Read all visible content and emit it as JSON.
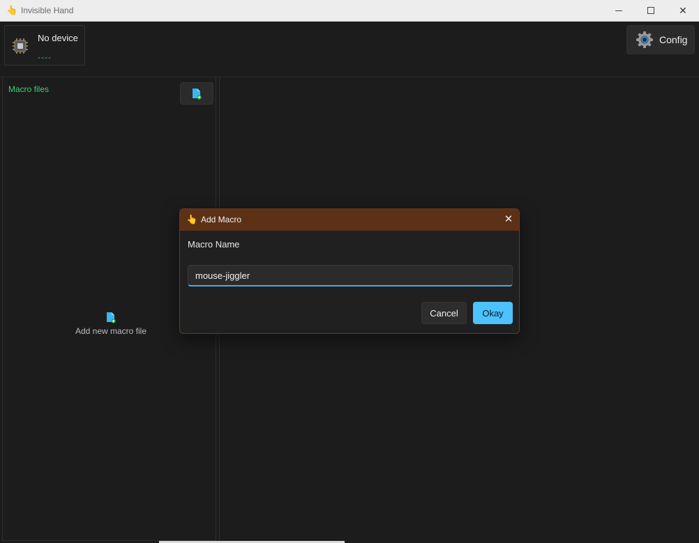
{
  "window": {
    "title": "Invisible Hand",
    "icon": "hand-icon"
  },
  "header": {
    "device": {
      "name": "No device",
      "status": "----",
      "icon": "chip-icon"
    },
    "config": {
      "label": "Config",
      "icon": "gear-icon"
    }
  },
  "sidebar": {
    "title": "Macro files",
    "empty_action_label": "Add new macro file"
  },
  "dialog": {
    "title": "Add Macro",
    "field_label": "Macro Name",
    "input_value": "mouse-jiggler",
    "cancel_label": "Cancel",
    "okay_label": "Okay"
  },
  "colors": {
    "accent": "#4cc2ff",
    "dialog_header": "#5c3116",
    "success": "#3fcf78"
  }
}
